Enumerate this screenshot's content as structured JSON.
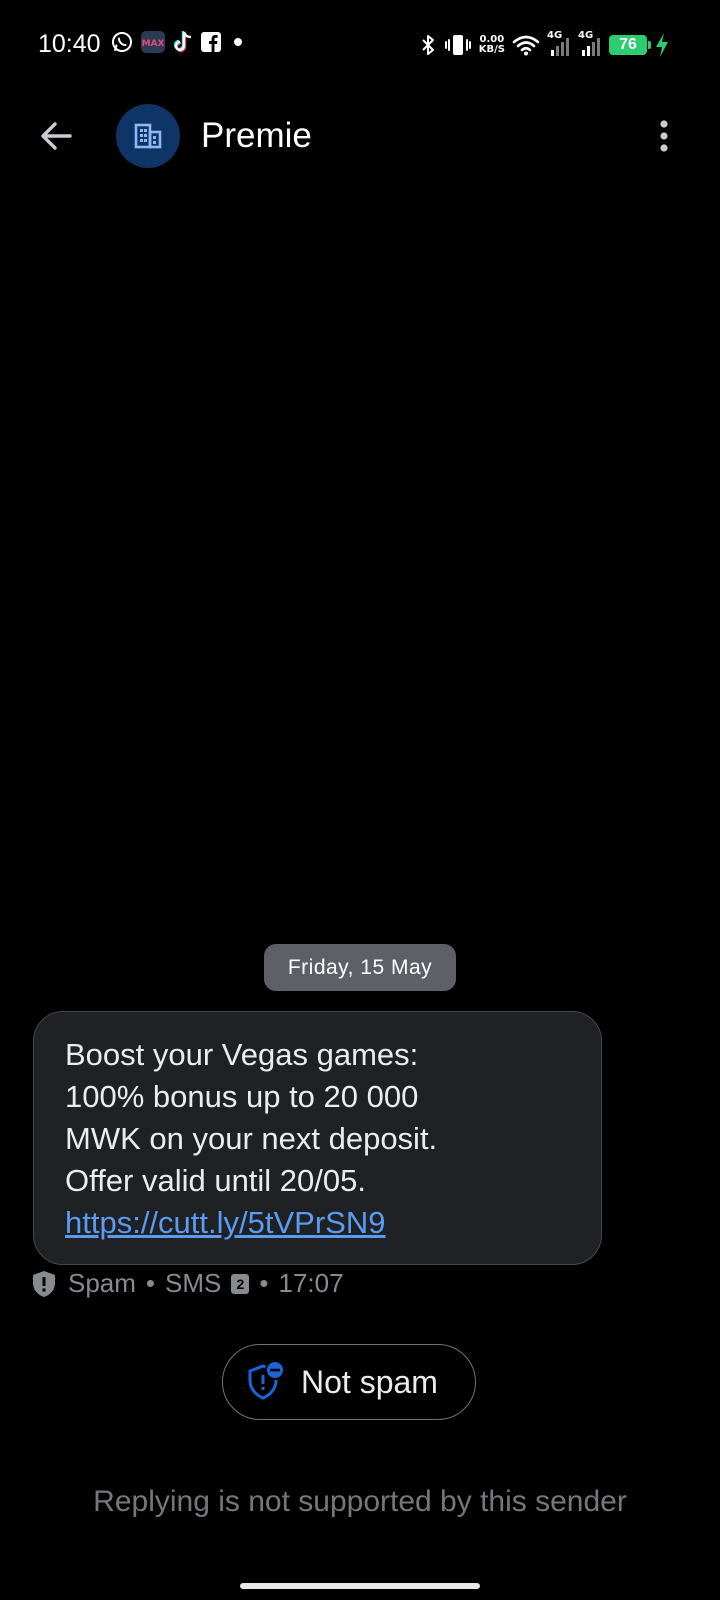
{
  "status_bar": {
    "time": "10:40",
    "notification_icons": [
      "whatsapp-icon",
      "app-max-icon",
      "tiktok-icon",
      "facebook-icon",
      "more-dot"
    ],
    "net_speed_value": "0.00",
    "net_speed_unit": "KB/S",
    "sim1_tag": "4G",
    "sim2_tag": "4G",
    "battery_level": "76",
    "battery_color": "#2ecc71"
  },
  "app_bar": {
    "contact_name": "Premie",
    "avatar_color": "#0e3566"
  },
  "conversation": {
    "date_label": "Friday, 15 May",
    "message": {
      "lines": [
        "Boost your Vegas games:",
        "100% bonus up to 20 000",
        "MWK on your next deposit.",
        "Offer valid until 20/05."
      ],
      "link": "https://cutt.ly/5tVPrSN9",
      "link_color": "#5b9cf0"
    },
    "meta": {
      "spam_label": "Spam",
      "separator": "•",
      "channel": "SMS",
      "sim_slot": "2",
      "time": "17:07"
    },
    "not_spam_button": "Not spam",
    "reply_note": "Replying is not supported by this sender"
  }
}
